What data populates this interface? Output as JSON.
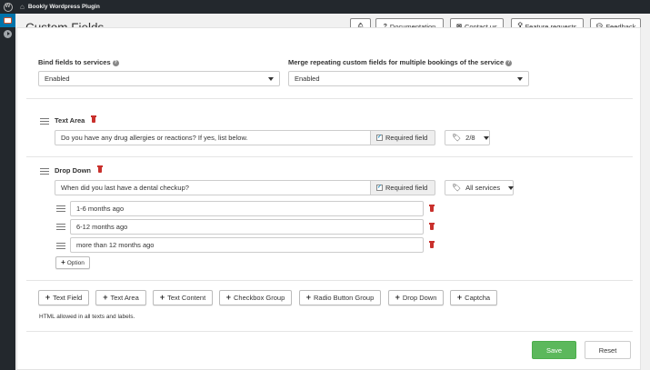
{
  "topbar": {
    "site_name": "Bookly Wordpress Plugin"
  },
  "header": {
    "title": "Custom Fields",
    "buttons": {
      "notifications_icon": "bell-icon",
      "documentation": "Documentation",
      "contact": "Contact us",
      "feature_requests": "Feature requests",
      "feedback": "Feedback"
    }
  },
  "settings": {
    "bind_label": "Bind fields to services",
    "bind_value": "Enabled",
    "merge_label": "Merge repeating custom fields for multiple bookings of the service",
    "merge_value": "Enabled"
  },
  "fields": [
    {
      "type_label": "Text Area",
      "question": "Do you have any drug allergies or reactions? If yes, list below.",
      "required_label": "Required field",
      "required_checked": true,
      "services_label": "2/8"
    },
    {
      "type_label": "Drop Down",
      "question": "When did you last have a dental checkup?",
      "required_label": "Required field",
      "required_checked": true,
      "services_label": "All services",
      "options": [
        "1-6 months ago",
        "6-12 months ago",
        "more than 12 months ago"
      ],
      "add_option_label": "Option"
    }
  ],
  "add_buttons": {
    "text_field": "Text Field",
    "text_area": "Text Area",
    "text_content": "Text Content",
    "checkbox_group": "Checkbox Group",
    "radio_button_group": "Radio Button Group",
    "drop_down": "Drop Down",
    "captcha": "Captcha"
  },
  "html_note": "HTML allowed in all texts and labels.",
  "footer": {
    "save": "Save",
    "reset": "Reset"
  },
  "colors": {
    "save_green": "#5cb85c",
    "trash_red": "#c9302c",
    "admin_bar": "#23282d"
  }
}
